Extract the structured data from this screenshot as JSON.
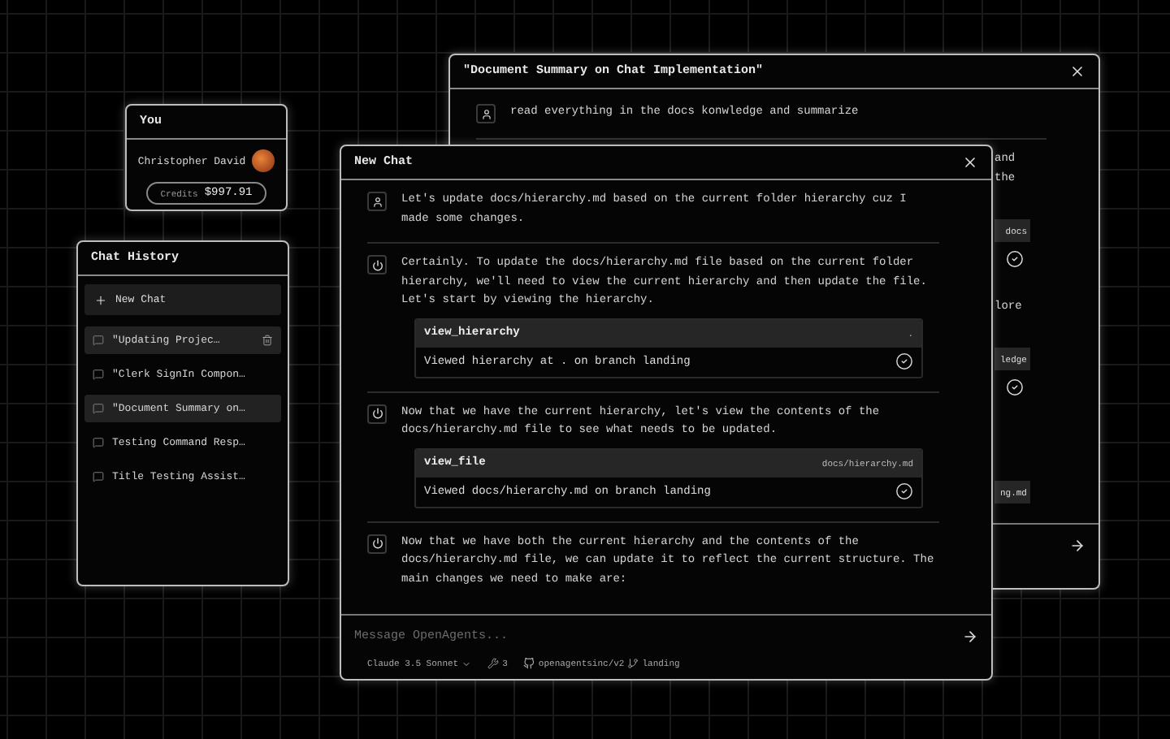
{
  "profile": {
    "title": "You",
    "name": "Christopher David",
    "credits_label": "Credits",
    "credits_value": "$997.91"
  },
  "history": {
    "title": "Chat History",
    "new_chat": "New Chat",
    "items": [
      {
        "title": "\"Updating Projec…",
        "selected": true,
        "show_delete": true
      },
      {
        "title": "\"Clerk SignIn Compon…",
        "selected": false,
        "show_delete": false
      },
      {
        "title": "\"Document Summary on…",
        "selected": true,
        "show_delete": false
      },
      {
        "title": "Testing Command Resp…",
        "selected": false,
        "show_delete": false
      },
      {
        "title": "Title Testing Assist…",
        "selected": false,
        "show_delete": false
      }
    ]
  },
  "back_window": {
    "title": "\"Document Summary on Chat Implementation\"",
    "user_message": "read everything in the docs konwledge and summarize",
    "fragments": [
      {
        "kind": "text",
        "text": "and"
      },
      {
        "kind": "text",
        "text": "the"
      },
      {
        "kind": "tool",
        "text": "docs"
      },
      {
        "kind": "check",
        "done": true
      },
      {
        "kind": "text",
        "text": "lore"
      },
      {
        "kind": "tool",
        "text": "ledge"
      },
      {
        "kind": "check",
        "done": true
      },
      {
        "kind": "tool",
        "text": "ng.md"
      }
    ]
  },
  "chat_window": {
    "title": "New Chat",
    "messages": [
      {
        "kind": "user",
        "text": "Let's update docs/hierarchy.md based on the current folder hierarchy cuz I made some changes."
      },
      {
        "kind": "assistant",
        "text": "Certainly. To update the docs/hierarchy.md file based on the current folder hierarchy, we'll need to view the current hierarchy and then update the file. Let's start by viewing the hierarchy.",
        "tool": {
          "name": "view_hierarchy",
          "arg": ".",
          "result": "Viewed hierarchy at . on branch landing",
          "done": true
        }
      },
      {
        "kind": "assistant",
        "text": "Now that we have the current hierarchy, let's view the contents of the docs/hierarchy.md file to see what needs to be updated.",
        "tool": {
          "name": "view_file",
          "arg": "docs/hierarchy.md",
          "result": "Viewed docs/hierarchy.md on branch landing",
          "done": true
        }
      },
      {
        "kind": "assistant",
        "text": "Now that we have both the current hierarchy and the contents of the docs/hierarchy.md file, we can update it to reflect the current structure. The main changes we need to make are:"
      }
    ],
    "input": {
      "placeholder": "Message OpenAgents..."
    },
    "model": "Claude 3.5 Sonnet",
    "tool_count": "3",
    "repo": "openagentsinc/v2",
    "branch": "landing"
  }
}
